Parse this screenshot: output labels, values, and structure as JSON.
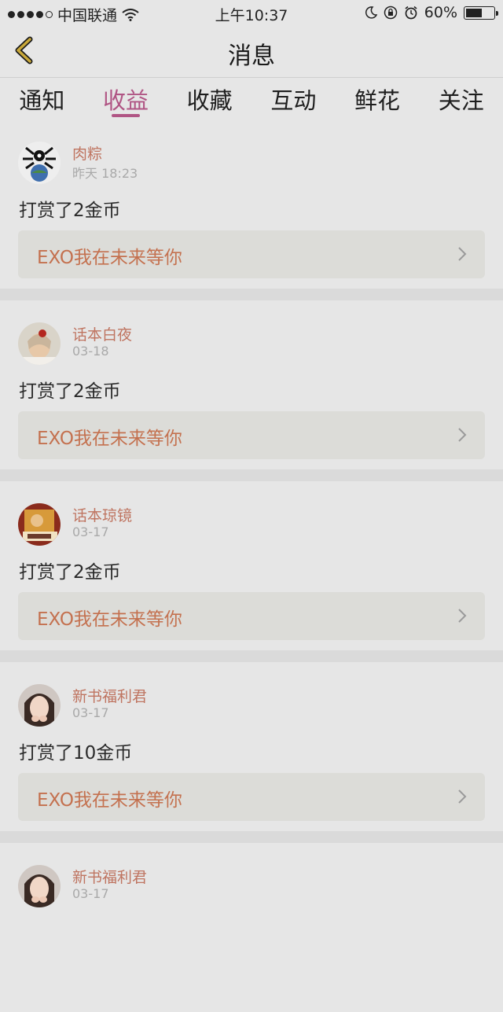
{
  "status_bar": {
    "carrier": "中国联通",
    "time": "上午10:37",
    "battery": "60%",
    "battery_level": 0.6
  },
  "nav": {
    "title": "消息"
  },
  "tabs": [
    {
      "label": "通知",
      "active": false
    },
    {
      "label": "收益",
      "active": true
    },
    {
      "label": "收藏",
      "active": false
    },
    {
      "label": "互动",
      "active": false
    },
    {
      "label": "鲜花",
      "active": false
    },
    {
      "label": "关注",
      "active": false
    }
  ],
  "notifications": [
    {
      "user": "肉粽",
      "time": "昨天 18:23",
      "action": "打赏了2金币",
      "book": "EXO我在未来等你"
    },
    {
      "user": "话本白夜",
      "time": "03-18",
      "action": "打赏了2金币",
      "book": "EXO我在未来等你"
    },
    {
      "user": "话本琼镜",
      "time": "03-17",
      "action": "打赏了2金币",
      "book": "EXO我在未来等你"
    },
    {
      "user": "新书福利君",
      "time": "03-17",
      "action": "打赏了10金币",
      "book": "EXO我在未来等你"
    },
    {
      "user": "新书福利君",
      "time": "03-17",
      "action": "",
      "book": ""
    }
  ],
  "colors": {
    "accent": "#b05584",
    "username": "#bf7460",
    "book_title": "#c4714f"
  }
}
